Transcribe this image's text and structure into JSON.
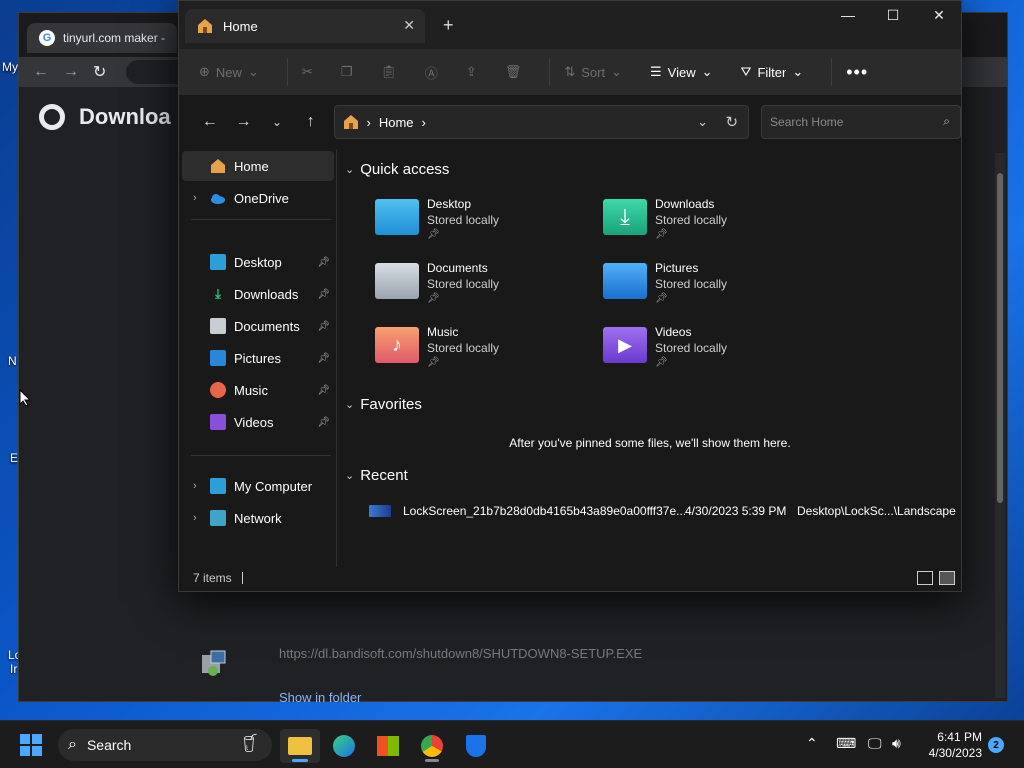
{
  "desktop": {
    "edge_labels": [
      "My",
      "N",
      "E",
      "Lo",
      "Ir"
    ]
  },
  "chrome": {
    "tab_title": "tinyurl.com maker -",
    "page_title": "Downloa",
    "download_url": "https://dl.bandisoft.com/shutdown8/SHUTDOWN8-SETUP.EXE",
    "show_in_folder": "Show in folder"
  },
  "explorer": {
    "tab_title": "Home",
    "toolbar": {
      "new": "New",
      "sort": "Sort",
      "view": "View",
      "filter": "Filter"
    },
    "address": {
      "path": "Home",
      "search_placeholder": "Search Home"
    },
    "sidebar": {
      "home": "Home",
      "onedrive": "OneDrive",
      "pinned": [
        "Desktop",
        "Downloads",
        "Documents",
        "Pictures",
        "Music",
        "Videos"
      ],
      "my_computer": "My Computer",
      "network": "Network"
    },
    "sections": {
      "quick_access": "Quick access",
      "favorites": "Favorites",
      "recent": "Recent"
    },
    "quick_access": [
      {
        "name": "Desktop",
        "sub": "Stored locally"
      },
      {
        "name": "Downloads",
        "sub": "Stored locally"
      },
      {
        "name": "Documents",
        "sub": "Stored locally"
      },
      {
        "name": "Pictures",
        "sub": "Stored locally"
      },
      {
        "name": "Music",
        "sub": "Stored locally"
      },
      {
        "name": "Videos",
        "sub": "Stored locally"
      }
    ],
    "favorites_empty": "After you've pinned some files, we'll show them here.",
    "recent": [
      {
        "name": "LockScreen_21b7b28d0db4165b43a89e0a00fff37e...",
        "date": "4/30/2023 5:39 PM",
        "location": "Desktop\\LockSc...\\Landscape"
      }
    ],
    "status": "7 items"
  },
  "taskbar": {
    "search": "Search",
    "time": "6:41 PM",
    "date": "4/30/2023",
    "notifications": "2"
  },
  "colors": {
    "accent": "#4aa8ff",
    "folder_blue": "#1e90d6",
    "folder_teal": "#1aa37a"
  }
}
